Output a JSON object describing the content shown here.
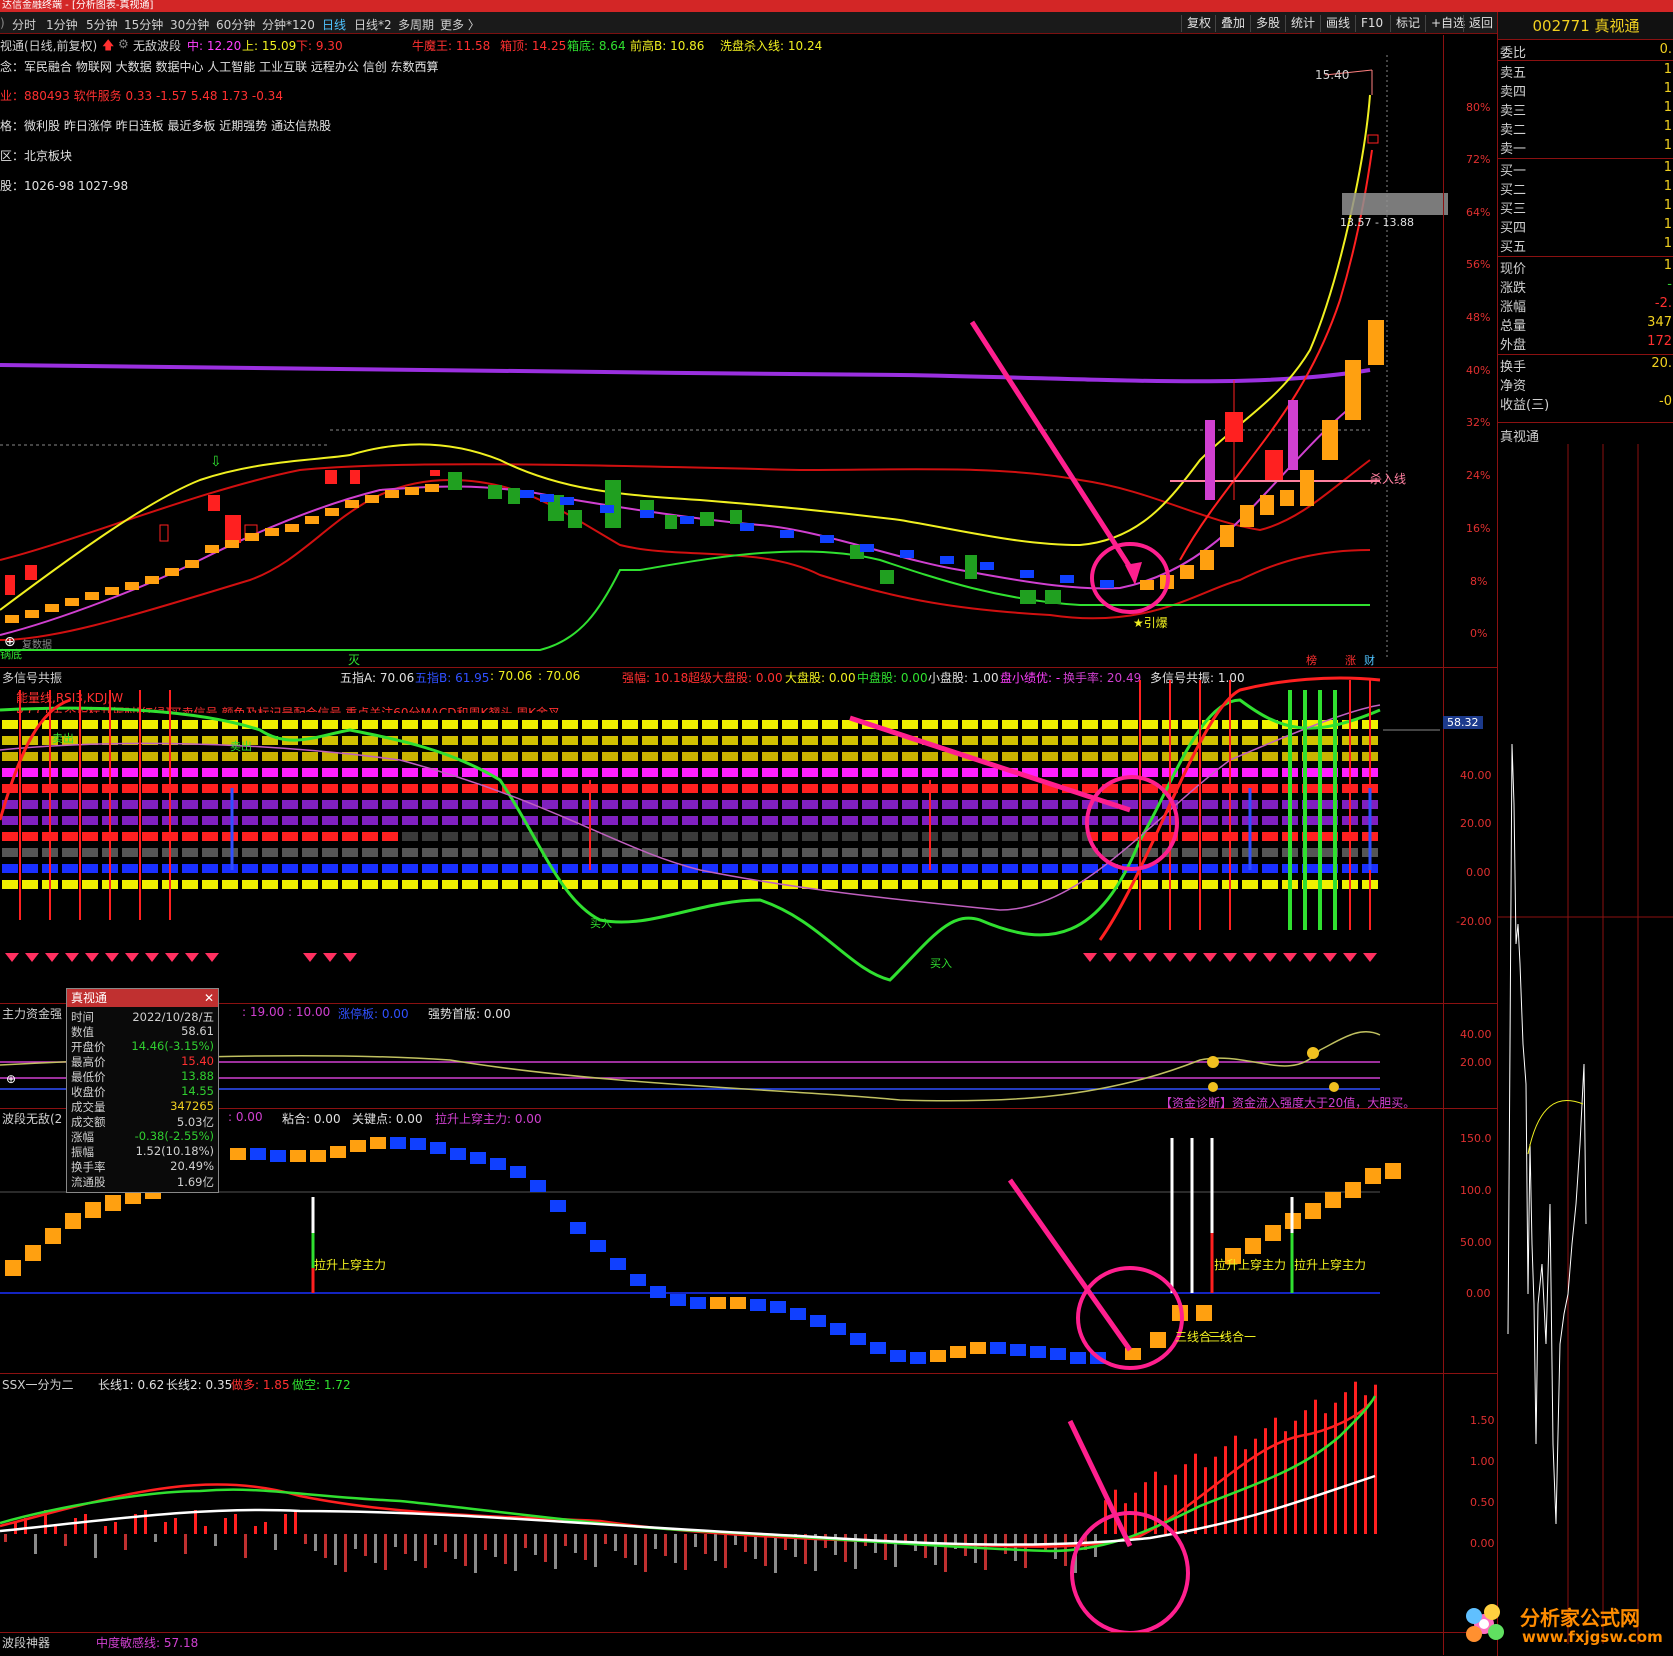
{
  "window_title": "达信金融终端 - [分析图表-真视通]",
  "toolbar": {
    "periods": [
      "分时",
      "1分钟",
      "5分钟",
      "15分钟",
      "30分钟",
      "60分钟",
      "分钟*120",
      "日线",
      "日线*2",
      "多周期",
      "更多 〉"
    ],
    "active_period": "日线",
    "buttons": [
      "复权",
      "叠加",
      "多股",
      "统计",
      "画线",
      "F10",
      "标记",
      "+自选",
      "返回"
    ]
  },
  "main_chart": {
    "stock_line": "视通(日线,前复权)",
    "indicator_name": "无敌波段",
    "mid_label": "中: 12.20",
    "up_label": "上: 15.09",
    "down_label": "下: 9.30",
    "bull_king": "牛魔王: 11.58",
    "box_top": "箱顶: 14.25",
    "box_bottom": "箱底: 8.64",
    "prev_high": "前高B: 10.86",
    "wash_line": "洗盘杀入线: 10.24",
    "concept": "念：军民融合 物联网 大数据 数据中心 人工智能 工业互联 远程办公 信创 东数西算",
    "industry": "业：880493 软件服务 0.33 -1.57 5.48 1.73 -0.34",
    "style": "格：微利股 昨日涨停 昨日连板 最近多板 近期强势 通达信热股",
    "region": "区：北京板块",
    "shares": "股：1026-98 1027-98",
    "peak_price": "15.40",
    "price_range": "13.57 - 13.88",
    "kill_line": "杀入线",
    "explode_label": "★引爆",
    "bottom_left": "锅底",
    "bottom_left2": "复数据",
    "mie_label": "灭",
    "bottom_tags": [
      "榜",
      "涨",
      "财"
    ],
    "pct_axis": [
      "80%",
      "72%",
      "64%",
      "56%",
      "48%",
      "40%",
      "32%",
      "24%",
      "16%",
      "8%",
      "0%"
    ]
  },
  "panel2": {
    "title": "多信号共振",
    "wuzhi_a": "五指A: 70.06",
    "wuzhi_b": "五指B: 61.95",
    "v1": ": 70.06",
    "v2": ": 70.06",
    "strong_rank": "强幅: 10.18",
    "super_big": "超级大盘股: 0.00",
    "big": "大盘股: 0.00",
    "mid": "中盘股: 0.00",
    "small": "小盘股: 1.00",
    "small_excel": "盘小绩优: -",
    "turnover": "换手率: 20.49",
    "resonance": "多信号共振: 1.00",
    "legend1": "能量线,RSI3,KDJ,W",
    "legend2": "R,CCI,五个指标共振时[红绿]买卖信号,颜色及标记是配合信号,重点关注60分MACD和周K翘头,周K金叉",
    "sell_label": "卖出",
    "sell_label2": "卖出",
    "buy_label": "买入",
    "buy_label2": "买入",
    "cur_value": "58.32",
    "axis": [
      "40.00",
      "20.00",
      "0.00",
      "-20.00"
    ]
  },
  "panel3": {
    "title": "主力资金强",
    "v1": ": 19.00",
    "v2": ": 10.00",
    "limit_up": "涨停板: 0.00",
    "strong_first": "强势首版: 0.00",
    "diagnosis": "【资金诊断】资金流入强度大于20值，大胆买。",
    "axis": [
      "40.00",
      "20.00"
    ]
  },
  "panel4": {
    "title": "波段无敌(2",
    "v0": ": 0.00",
    "stick": "粘合: 0.00",
    "key_point": "关键点: 0.00",
    "lift": "拉升上穿主力: 0.00",
    "lift_label": "拉升上穿主力",
    "three_lines": "三线合一",
    "axis": [
      "150.0",
      "100.0",
      "50.00",
      "0.00"
    ]
  },
  "panel5": {
    "title": "SSX一分为二",
    "long1": "长线1: 0.62",
    "long2": "长线2: 0.35",
    "do_long": "做多: 1.85",
    "do_short": "做空: 1.72",
    "axis": [
      "1.50",
      "1.00",
      "0.50",
      "0.00"
    ]
  },
  "panel6": {
    "title": "波段神器",
    "sense": "中度敏感线: 57.18"
  },
  "popup": {
    "title": "真视通",
    "rows": [
      {
        "label": "时间",
        "value": "2022/10/28/五",
        "color": "#d0d0d0"
      },
      {
        "label": "数值",
        "value": "58.61",
        "color": "#d0d0d0"
      },
      {
        "label": "开盘价",
        "value": "14.46(-3.15%)",
        "color": "#30d030"
      },
      {
        "label": "最高价",
        "value": "15.40",
        "color": "#ff3030"
      },
      {
        "label": "最低价",
        "value": "13.88",
        "color": "#30d030"
      },
      {
        "label": "收盘价",
        "value": "14.55",
        "color": "#30d030"
      },
      {
        "label": "成交量",
        "value": "347265",
        "color": "#f0d020"
      },
      {
        "label": "成交额",
        "value": "5.03亿",
        "color": "#d0d0d0"
      },
      {
        "label": "涨幅",
        "value": "-0.38(-2.55%)",
        "color": "#30d030"
      },
      {
        "label": "振幅",
        "value": "1.52(10.18%)",
        "color": "#d0d0d0"
      },
      {
        "label": "换手率",
        "value": "20.49%",
        "color": "#d0d0d0"
      },
      {
        "label": "流通股",
        "value": "1.69亿",
        "color": "#d0d0d0"
      }
    ]
  },
  "right_panel": {
    "code_name": "002771 真视通",
    "rows": [
      {
        "label": "委比",
        "value": "0."
      },
      {
        "label": "卖五",
        "value": "1"
      },
      {
        "label": "卖四",
        "value": "1"
      },
      {
        "label": "卖三",
        "value": "1"
      },
      {
        "label": "卖二",
        "value": "1"
      },
      {
        "label": "卖一",
        "value": "1"
      },
      {
        "label": "买一",
        "value": "1"
      },
      {
        "label": "买二",
        "value": "1"
      },
      {
        "label": "买三",
        "value": "1"
      },
      {
        "label": "买四",
        "value": "1"
      },
      {
        "label": "买五",
        "value": "1"
      },
      {
        "label": "现价",
        "value": "1"
      },
      {
        "label": "涨跌",
        "value": "-"
      },
      {
        "label": "涨幅",
        "value": "-2."
      },
      {
        "label": "总量",
        "value": "347"
      },
      {
        "label": "外盘",
        "value": "172"
      },
      {
        "label": "换手",
        "value": "20."
      },
      {
        "label": "净资",
        "value": ""
      },
      {
        "label": "收益(三)",
        "value": "-0"
      }
    ],
    "mini_title": "真视通"
  },
  "watermark": {
    "text1": "分析家公式网",
    "text2": "www.fxjgsw.com"
  }
}
